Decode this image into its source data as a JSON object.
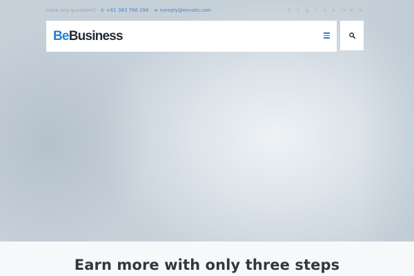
{
  "topbar": {
    "question": "Have any questions?",
    "phone": "+61 383 766 284",
    "email": "noreply@envato.com"
  },
  "socials": [
    "skype-icon",
    "facebook-icon",
    "google-plus-icon",
    "twitter-icon",
    "vimeo-icon",
    "youtube-icon",
    "flickr-icon",
    "linkedin-icon",
    "pinterest-icon"
  ],
  "social_glyphs": [
    "S",
    "f",
    "g",
    "t",
    "v",
    "▸",
    "••",
    "in",
    "p"
  ],
  "header": {
    "logo_be": "Be",
    "logo_business": "Business"
  },
  "section": {
    "title": "Earn more with only three steps"
  },
  "colors": {
    "accent": "#2b7fcf",
    "text_dark": "#222b33"
  }
}
